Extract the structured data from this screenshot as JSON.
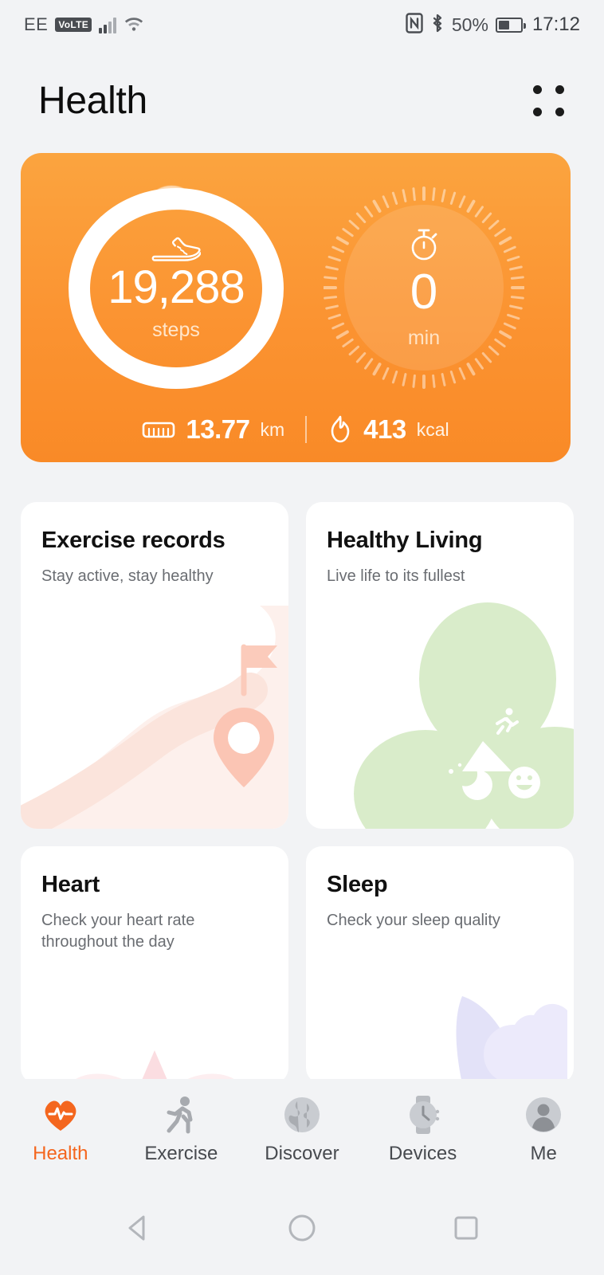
{
  "status_bar": {
    "carrier": "EE",
    "volte_badge": "VoLTE",
    "battery_percent": "50%",
    "time": "17:12",
    "icons": [
      "signal-bars-icon",
      "wifi-icon",
      "nfc-icon",
      "bluetooth-icon",
      "battery-icon"
    ]
  },
  "header": {
    "title": "Health",
    "menu_icon": "grid-dots-icon"
  },
  "summary": {
    "steps": {
      "value": "19,288",
      "unit": "steps",
      "icon": "shoe-icon"
    },
    "duration": {
      "value": "0",
      "unit": "min",
      "icon": "stopwatch-icon"
    },
    "distance": {
      "value": "13.77",
      "unit": "km",
      "icon": "ruler-icon"
    },
    "calories": {
      "value": "413",
      "unit": "kcal",
      "icon": "flame-icon"
    }
  },
  "cards": [
    {
      "title": "Exercise records",
      "subtitle": "Stay active, stay healthy",
      "art": "route-map-pin-flag-illustration",
      "accent": "#fbd9ce"
    },
    {
      "title": "Healthy Living",
      "subtitle": "Live life to its fullest",
      "art": "green-clover-illustration",
      "accent": "#d7ebc7"
    },
    {
      "title": "Heart",
      "subtitle": "Check your heart rate throughout the day",
      "art": "pink-heart-illustration",
      "accent": "#fdeff0"
    },
    {
      "title": "Sleep",
      "subtitle": "Check your sleep quality",
      "art": "lavender-moon-cloud-illustration",
      "accent": "#e4e3f8"
    }
  ],
  "bottom_nav": {
    "active_color": "#f4661e",
    "items": [
      {
        "label": "Health",
        "icon": "heart-pulse-icon",
        "active": true
      },
      {
        "label": "Exercise",
        "icon": "running-person-icon",
        "active": false
      },
      {
        "label": "Discover",
        "icon": "globe-icon",
        "active": false
      },
      {
        "label": "Devices",
        "icon": "watch-icon",
        "active": false
      },
      {
        "label": "Me",
        "icon": "person-avatar-icon",
        "active": false
      }
    ]
  },
  "system_nav": {
    "back": "back-triangle-icon",
    "home": "home-circle-icon",
    "recents": "recents-square-icon"
  }
}
